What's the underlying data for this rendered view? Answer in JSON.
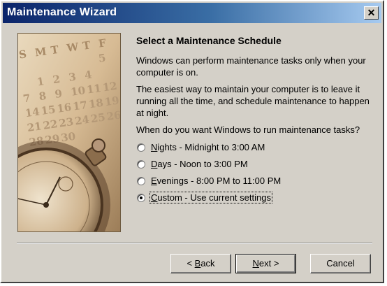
{
  "window": {
    "title": "Maintenance Wizard",
    "close_glyph": "✕"
  },
  "side_image": {
    "icon": "calendar-stopwatch-illustration",
    "calendar_header": [
      "S",
      "M",
      "T",
      "W",
      "T",
      "F"
    ],
    "calendar_rows": [
      [
        "",
        "",
        "",
        "",
        "",
        "5"
      ],
      [
        "",
        "1",
        "2",
        "3",
        "4",
        ""
      ],
      [
        "7",
        "8",
        "9",
        "10",
        "11",
        "12"
      ],
      [
        "14",
        "15",
        "16",
        "17",
        "18",
        "19"
      ],
      [
        "21",
        "22",
        "23",
        "24",
        "25",
        "26"
      ],
      [
        "28",
        "29",
        "30",
        "",
        "",
        ""
      ]
    ]
  },
  "content": {
    "heading": "Select a Maintenance Schedule",
    "para1": "Windows can perform maintenance tasks only when your computer is on.",
    "para2": "The easiest way to maintain your computer is to leave it running all the time, and schedule maintenance to happen at night.",
    "question": "When do you want Windows to run maintenance tasks?"
  },
  "options": [
    {
      "accel": "N",
      "rest": "ights - Midnight to 3:00 AM",
      "selected": false
    },
    {
      "accel": "D",
      "rest": "ays - Noon to 3:00 PM",
      "selected": false
    },
    {
      "accel": "E",
      "rest": "venings - 8:00 PM to 11:00 PM",
      "selected": false
    },
    {
      "accel": "C",
      "rest": "ustom - Use current settings",
      "selected": true
    }
  ],
  "buttons": {
    "back_prefix": "< ",
    "back_accel": "B",
    "back_rest": "ack",
    "next_accel": "N",
    "next_rest": "ext >",
    "cancel": "Cancel"
  }
}
